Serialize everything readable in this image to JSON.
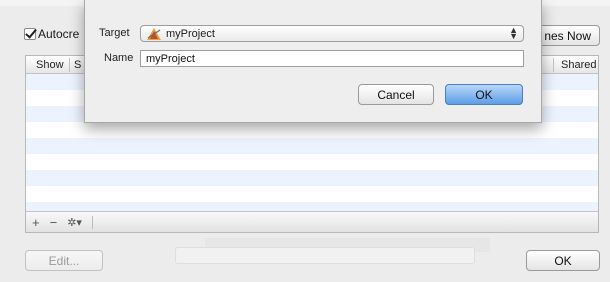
{
  "window": {
    "autocreate_label": "Autocre",
    "schemes_now_label": "nes Now",
    "edit_label": "Edit...",
    "ok_label": "OK"
  },
  "table": {
    "columns": [
      "Show",
      "S",
      "Shared"
    ],
    "row_count": 9,
    "footer": {
      "add": "+",
      "remove": "−",
      "action": "✲▾"
    }
  },
  "sheet": {
    "target_label": "Target",
    "target_value": "myProject",
    "name_label": "Name",
    "name_value": "myProject",
    "cancel_label": "Cancel",
    "ok_label": "OK"
  },
  "colors": {
    "default_button": "#5c9de8",
    "row_alt": "#edf3fe"
  }
}
